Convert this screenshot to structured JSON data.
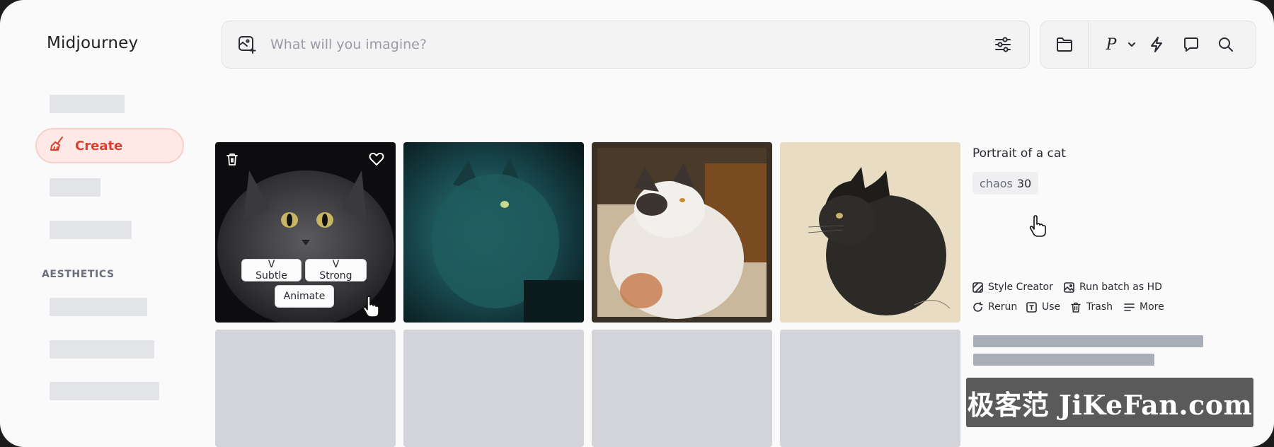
{
  "app": {
    "brand": "Midjourney"
  },
  "sidebar": {
    "create_label": "Create",
    "aesthetics_label": "AESTHETICS"
  },
  "search": {
    "placeholder": "What will you imagine?",
    "value": ""
  },
  "toolbar": {
    "personalize_letter": "P"
  },
  "grid": {
    "overlay_buttons": {
      "vary_subtle": "V Subtle",
      "vary_strong": "V Strong",
      "animate": "Animate"
    }
  },
  "detail": {
    "prompt": "Portrait of a cat",
    "param_key": "chaos",
    "param_value": "30",
    "actions": {
      "style_creator": "Style Creator",
      "run_batch_hd": "Run batch as HD",
      "rerun": "Rerun",
      "use": "Use",
      "trash": "Trash",
      "more": "More"
    }
  },
  "watermark": {
    "text": "极客范 JiKeFan.com"
  },
  "colors": {
    "accent": "#d8432f",
    "accent_bg": "#fee9e7",
    "skeleton": "#e3e4e8",
    "placeholder_tile": "#d3d4d9"
  }
}
